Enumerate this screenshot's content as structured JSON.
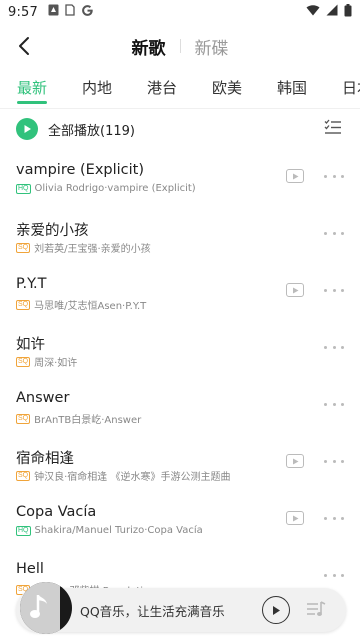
{
  "status_bar": {
    "time": "9:57"
  },
  "header": {
    "tabs": [
      {
        "label": "新歌",
        "active": true
      },
      {
        "label": "新碟",
        "active": false
      }
    ]
  },
  "categories": [
    {
      "label": "最新",
      "active": true
    },
    {
      "label": "内地",
      "active": false
    },
    {
      "label": "港台",
      "active": false
    },
    {
      "label": "欧美",
      "active": false
    },
    {
      "label": "韩国",
      "active": false
    },
    {
      "label": "日本",
      "active": false
    }
  ],
  "play_all": {
    "label": "全部播放",
    "count": "(119)"
  },
  "songs": [
    {
      "title": "vampire (Explicit)",
      "quality": "HQ",
      "sub": "Olivia Rodrigo·vampire (Explicit)",
      "has_mv": true
    },
    {
      "title": "亲爱的小孩",
      "quality": "SQ",
      "sub": "刘若英/王宝强·亲爱的小孩",
      "has_mv": false
    },
    {
      "title": "P.Y.T",
      "quality": "SQ",
      "sub": "马思唯/艾志恒Asen·P.Y.T",
      "has_mv": true
    },
    {
      "title": "如许",
      "quality": "SQ",
      "sub": "周深·如许",
      "has_mv": false
    },
    {
      "title": "Answer",
      "quality": "SQ",
      "sub": "BrAnTB白景屹·Answer",
      "has_mv": false
    },
    {
      "title": "宿命相逢",
      "quality": "SQ",
      "sub": "钟汉良·宿命相逢 《逆水寒》手游公测主题曲",
      "has_mv": true
    },
    {
      "title": "Copa Vacía",
      "quality": "HQ",
      "sub": "Shakira/Manuel Turizo·Copa Vacía",
      "has_mv": true
    },
    {
      "title": "Hell",
      "quality": "SQ",
      "sub": "G.E.M. 邓紫棋·Revelation",
      "has_mv": false
    }
  ],
  "mini_player": {
    "text": "QQ音乐，让生活充满音乐"
  },
  "colors": {
    "accent": "#31c27c",
    "hq": "#31c27c",
    "sq": "#f0a43a"
  },
  "icons": {
    "back": "chevron-left-icon",
    "play_all": "play-circle-icon",
    "multi_select": "list-check-icon",
    "mv": "video-play-icon",
    "more": "more-dots-icon",
    "playlist": "playlist-icon"
  }
}
